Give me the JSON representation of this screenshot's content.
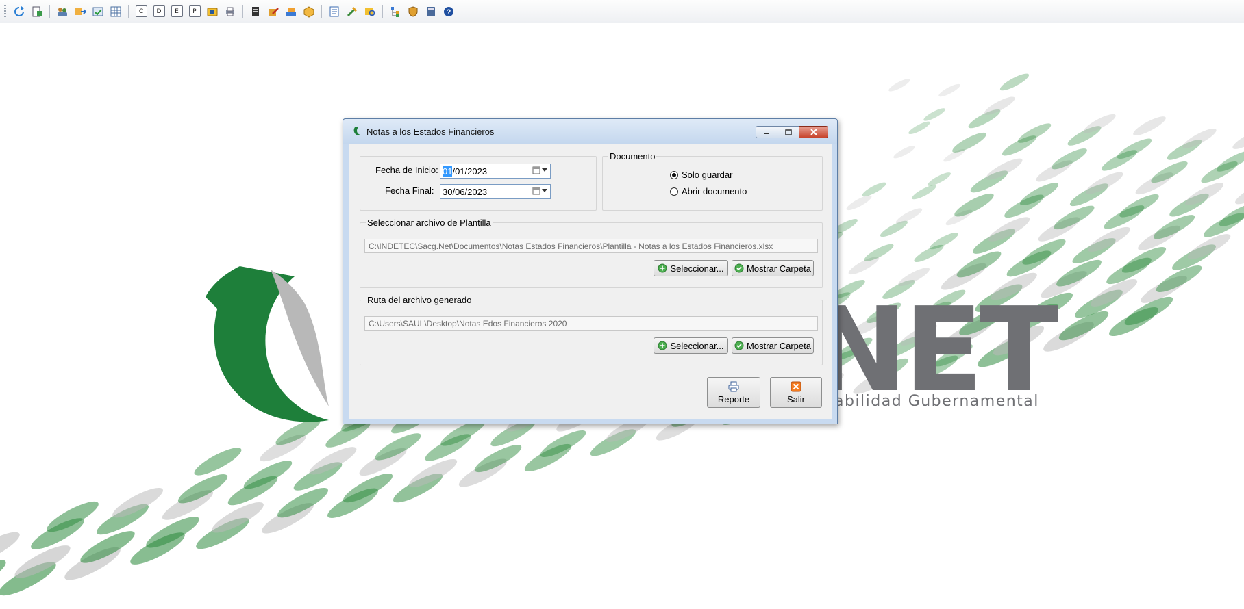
{
  "toolbar": {
    "icons": [
      "refresh-icon",
      "document-icon",
      "users-icon",
      "import-icon",
      "check-list-icon",
      "grid-icon",
      "C",
      "D",
      "E",
      "P",
      "folder-tag-icon",
      "print-icon",
      "clipboard-icon",
      "edit-icon",
      "stack-icon",
      "package-icon",
      "notes-icon",
      "tools-icon",
      "search-folder-icon",
      "hierarchy-icon",
      "shield-icon",
      "calculator-icon",
      "help-icon"
    ],
    "letters": [
      "C",
      "D",
      "E",
      "P"
    ]
  },
  "background": {
    "logo_text": "NET",
    "logo_subtitle": "abilidad Gubernamental",
    "accent": "#2e8b3e"
  },
  "dialog": {
    "title": "Notas a los Estados Financieros",
    "fecha_inicio_label": "Fecha de Inicio:",
    "fecha_inicio_sel": "01",
    "fecha_inicio_rest": "/01/2023",
    "fecha_final_label": "Fecha Final:",
    "fecha_final_value": "30/06/2023",
    "documento_title": "Documento",
    "radio_solo_guardar": "Solo guardar",
    "radio_abrir": "Abrir documento",
    "radio_selected": "Solo guardar",
    "plantilla_title": "Seleccionar archivo de Plantilla",
    "plantilla_path": "C:\\INDETEC\\Sacg.Net\\Documentos\\Notas Estados Financieros\\Plantilla - Notas a los Estados Financieros.xlsx",
    "ruta_title": "Ruta del archivo generado",
    "ruta_path": "C:\\Users\\SAUL\\Desktop\\Notas Edos Financieros 2020",
    "btn_seleccionar": "Seleccionar...",
    "btn_mostrar": "Mostrar Carpeta",
    "btn_reporte": "Reporte",
    "btn_salir": "Salir"
  }
}
